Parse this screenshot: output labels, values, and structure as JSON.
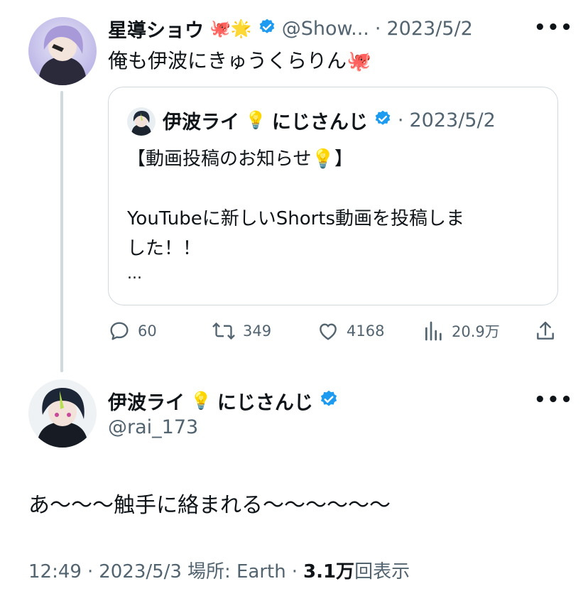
{
  "reply_parent": {
    "author_name": "星導ショウ",
    "author_emoji": "🐙🌟",
    "handle": "@Show...",
    "separator": "·",
    "date": "2023/5/2",
    "text": "俺も伊波にきゅうくらりん🐙",
    "quoted": {
      "author_name": "伊波ライ",
      "author_emoji": "💡",
      "author_suffix": "にじさんじ",
      "separator": "·",
      "date": "2023/5/2",
      "line1": "【動画投稿のお知らせ💡】",
      "line2": "YouTubeに新しいShorts動画を投稿しま",
      "line3": "した！！",
      "line4": "..."
    },
    "actions": {
      "replies": "60",
      "retweets": "349",
      "likes": "4168",
      "views": "20.9万"
    }
  },
  "main_tweet": {
    "author_name": "伊波ライ",
    "author_emoji": "💡",
    "author_suffix": "にじさんじ",
    "handle": "@rai_173",
    "text": "あ〜〜〜触手に絡まれる〜〜〜〜〜〜",
    "time": "12:49",
    "sep1": "·",
    "date": "2023/5/3",
    "location_label": "場所: Earth",
    "sep2": "·",
    "views_count": "3.1万",
    "views_label": "回表示"
  },
  "colors": {
    "verified": "#1d9bf0",
    "text": "#0f1419",
    "muted": "#536471",
    "thread_line": "#cfd9de",
    "card_border": "#cfd9de"
  },
  "icons": [
    "reply-icon",
    "retweet-icon",
    "like-icon",
    "views-icon",
    "share-icon",
    "more-icon",
    "verified-badge-icon"
  ]
}
